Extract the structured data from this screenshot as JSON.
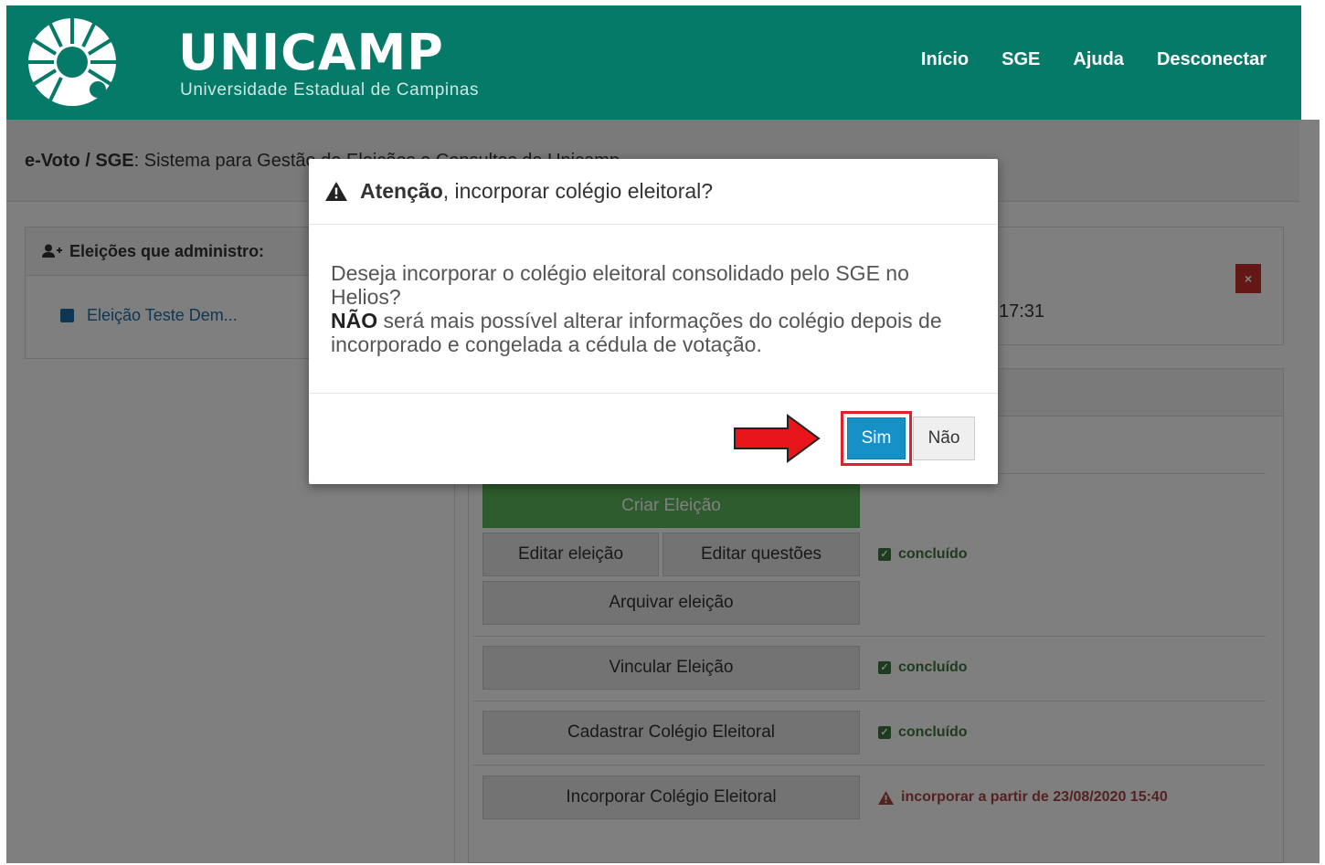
{
  "header": {
    "brand": "UNICAMP",
    "brand_sub": "Universidade Estadual de Campinas",
    "nav": [
      "Início",
      "SGE",
      "Ajuda",
      "Desconectar"
    ]
  },
  "breadcrumb": {
    "strong": "e-Voto / SGE",
    "rest": ": Sistema para Gestão de Eleições e Consultas da Unicamp"
  },
  "left_panel": {
    "title": "Eleições que administro:",
    "item": "Eleição Teste Dem..."
  },
  "right_top": {
    "close_label": "×",
    "time_fragment": "17:31"
  },
  "steps": {
    "criar": "Criar Eleição",
    "editar_eleicao": "Editar eleição",
    "editar_questoes": "Editar questões",
    "arquivar": "Arquivar eleição",
    "vincular": "Vincular Eleição",
    "cadastrar": "Cadastrar Colégio Eleitoral",
    "incorporar": "Incorporar Colégio Eleitoral",
    "status_done": "concluído",
    "status_warn": "incorporar a partir de 23/08/2020 15:40"
  },
  "modal": {
    "title_strong": "Atenção",
    "title_rest": ", incorporar colégio eleitoral?",
    "body_line1": "Deseja incorporar o colégio eleitoral consolidado pelo SGE no Helios?",
    "body_strong": "NÃO",
    "body_line2": " será mais possível alterar informações do colégio depois de incorporado e congelada a cédula de votação.",
    "yes_label": "Sim",
    "no_label": "Não"
  },
  "colors": {
    "header_bg": "#067a69",
    "primary_button": "#1591c8",
    "highlight": "#e0202a",
    "success": "#3c763d",
    "danger": "#a94442"
  }
}
